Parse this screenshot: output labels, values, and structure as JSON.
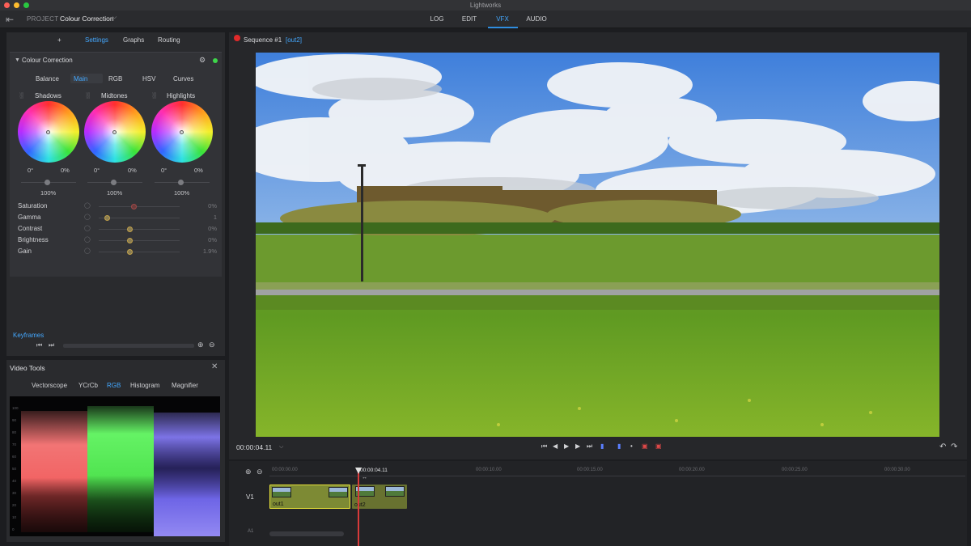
{
  "app": {
    "title": "Lightworks"
  },
  "project": {
    "label": "PROJECT",
    "name": "Colour Correction"
  },
  "main_tabs": [
    {
      "label": "LOG"
    },
    {
      "label": "EDIT"
    },
    {
      "label": "VFX"
    },
    {
      "label": "AUDIO"
    }
  ],
  "active_main_tab": "VFX",
  "left_tabs": {
    "add": "+",
    "settings": "Settings",
    "graphs": "Graphs",
    "routing": "Routing"
  },
  "cc": {
    "title": "Colour Correction",
    "subtabs": [
      "Balance",
      "Main",
      "RGB",
      "HSV",
      "Curves"
    ],
    "wheels": [
      {
        "name": "Shadows",
        "angle": "0°",
        "amount": "0%",
        "level": "100%"
      },
      {
        "name": "Midtones",
        "angle": "0°",
        "amount": "0%",
        "level": "100%"
      },
      {
        "name": "Highlights",
        "angle": "0°",
        "amount": "0%",
        "level": "100%"
      }
    ],
    "params": [
      {
        "label": "Saturation",
        "value": "0%"
      },
      {
        "label": "Gamma",
        "value": "1"
      },
      {
        "label": "Contrast",
        "value": "0%"
      },
      {
        "label": "Brightness",
        "value": "0%"
      },
      {
        "label": "Gain",
        "value": "1.9%"
      }
    ]
  },
  "keyframes": {
    "label": "Keyframes"
  },
  "video_tools": {
    "title": "Video Tools",
    "tabs": [
      "Vectorscope",
      "YCrCb",
      "RGB",
      "Histogram",
      "Magnifier"
    ],
    "active": "RGB",
    "scale": [
      "100",
      "90",
      "80",
      "70",
      "60",
      "50",
      "40",
      "30",
      "20",
      "10",
      "0"
    ]
  },
  "viewer": {
    "sequence": "Sequence #1",
    "sequence_tag": "[out2]",
    "timecode": "00:00:04.11"
  },
  "timeline": {
    "ruler": [
      "00:00:00.00",
      "00:00:04.11",
      "00:00:10.00",
      "00:00:15.00",
      "00:00:20.00",
      "00:00:25.00",
      "00:00:30.00"
    ],
    "playhead_tc": "00:00:04.11",
    "track_video": "V1",
    "track_audio": "A1",
    "clips": [
      {
        "label": "out1"
      },
      {
        "label": "out2"
      }
    ]
  },
  "colors": {
    "accent": "#44a8ff",
    "record": "#e02a2a",
    "clip": "#7d8a34",
    "clip_selected_border": "#e8e23a"
  }
}
